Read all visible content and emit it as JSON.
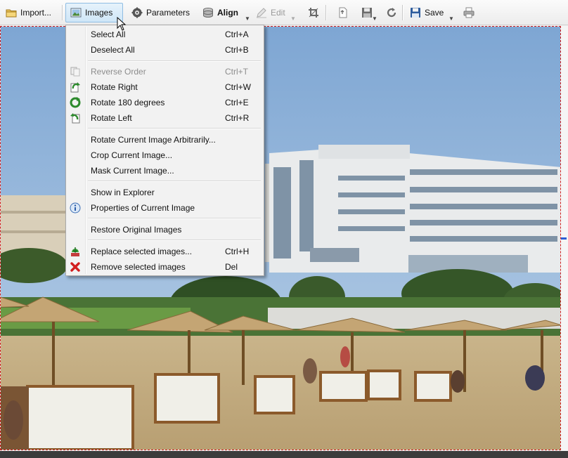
{
  "toolbar": {
    "import_label": "Import...",
    "images_label": "Images",
    "parameters_label": "Parameters",
    "align_label": "Align",
    "edit_label": "Edit",
    "save_label": "Save"
  },
  "menu": {
    "select_all": {
      "label": "Select All",
      "shortcut": "Ctrl+A"
    },
    "deselect_all": {
      "label": "Deselect All",
      "shortcut": "Ctrl+B"
    },
    "reverse_order": {
      "label": "Reverse Order",
      "shortcut": "Ctrl+T"
    },
    "rotate_right": {
      "label": "Rotate Right",
      "shortcut": "Ctrl+W"
    },
    "rotate_180": {
      "label": "Rotate 180 degrees",
      "shortcut": "Ctrl+E"
    },
    "rotate_left": {
      "label": "Rotate Left",
      "shortcut": "Ctrl+R"
    },
    "rotate_arbitrary": {
      "label": "Rotate Current Image Arbitrarily..."
    },
    "crop_current": {
      "label": "Crop Current Image..."
    },
    "mask_current": {
      "label": "Mask Current Image..."
    },
    "show_in_explorer": {
      "label": "Show in Explorer"
    },
    "properties": {
      "label": "Properties of Current Image"
    },
    "restore_original": {
      "label": "Restore Original Images"
    },
    "replace_selected": {
      "label": "Replace selected images...",
      "shortcut": "Ctrl+H"
    },
    "remove_selected": {
      "label": "Remove selected images",
      "shortcut": "Del"
    }
  },
  "colors": {
    "selection_border": "#d21e1e",
    "active_button": "#cfe6f7",
    "sky": "#8fb2d6"
  },
  "icons": {
    "import": "folder-icon",
    "images": "images-icon",
    "parameters": "parameters-icon",
    "align": "align-icon",
    "edit": "edit-icon",
    "crop": "crop-icon",
    "export": "export-icon",
    "save_as": "save-as-icon",
    "refresh": "refresh-icon",
    "save": "save-icon",
    "print": "print-icon"
  }
}
